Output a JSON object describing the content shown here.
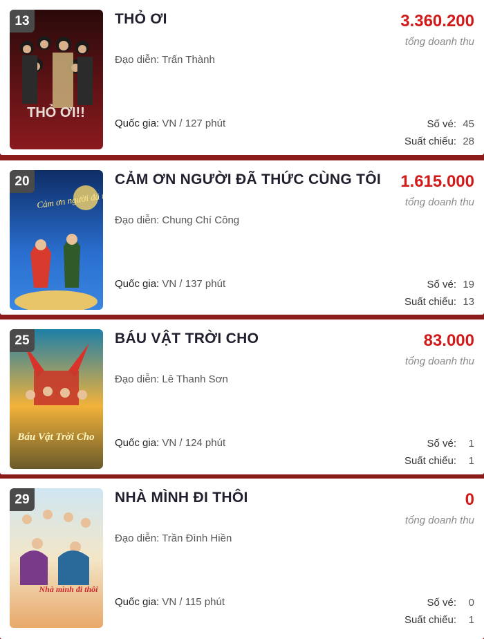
{
  "labels": {
    "revenue_caption": "tổng doanh thu",
    "director_prefix": "Đạo diễn:",
    "country_prefix": "Quốc gia:",
    "tickets_label": "Số vé:",
    "shows_label": "Suất chiếu:"
  },
  "movies": [
    {
      "rank": "13",
      "title": "THỎ ƠI",
      "revenue": "3.360.200",
      "director": "Trấn Thành",
      "country_runtime": "VN / 127 phút",
      "tickets": "45",
      "shows": "28",
      "poster_text": "THỎ ƠI!!",
      "poster_colors": [
        "#3a0a0c",
        "#7a1418"
      ]
    },
    {
      "rank": "20",
      "title": "CẢM ƠN NGƯỜI ĐÃ THỨC CÙNG TÔI",
      "revenue": "1.615.000",
      "director": "Chung Chí Công",
      "country_runtime": "VN / 137 phút",
      "tickets": "19",
      "shows": "13",
      "poster_text": "Cảm ơn người đã thức cùng tôi",
      "poster_colors": [
        "#123a7a",
        "#2a6fd0"
      ]
    },
    {
      "rank": "25",
      "title": "BÁU VẬT TRỜI CHO",
      "revenue": "83.000",
      "director": "Lê Thanh Sơn",
      "country_runtime": "VN / 124 phút",
      "tickets": "1",
      "shows": "1",
      "poster_text": "Báu Vật Trời Cho",
      "poster_colors": [
        "#1d7fa8",
        "#f2b23a"
      ]
    },
    {
      "rank": "29",
      "title": "NHÀ MÌNH ĐI THÔI",
      "revenue": "0",
      "director": "Trần Đình Hiền",
      "country_runtime": "VN / 115 phút",
      "tickets": "0",
      "shows": "1",
      "poster_text": "Nhà mình đi thôi",
      "poster_colors": [
        "#f3e6c8",
        "#e8a86a"
      ]
    }
  ]
}
